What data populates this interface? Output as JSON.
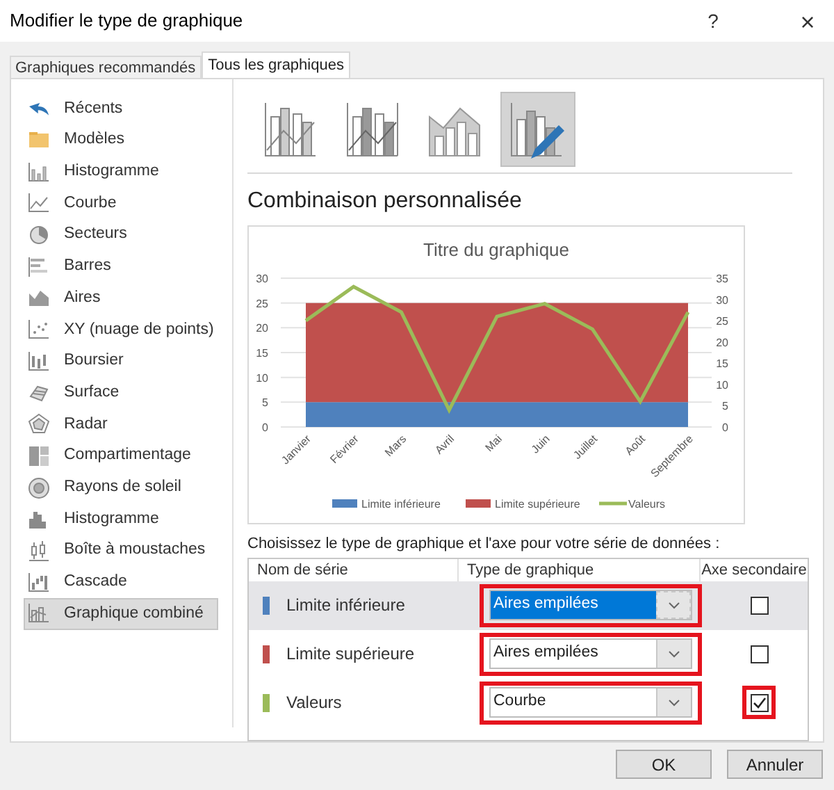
{
  "window": {
    "title": "Modifier le type de graphique",
    "help": "?",
    "close": "×"
  },
  "tabs": [
    {
      "label": "Graphiques recommandés",
      "selected": false
    },
    {
      "label": "Tous les graphiques",
      "selected": true
    }
  ],
  "sidebar": {
    "items": [
      {
        "label": "Récents",
        "selected": false
      },
      {
        "label": "Modèles",
        "selected": false
      },
      {
        "label": "Histogramme",
        "selected": false
      },
      {
        "label": "Courbe",
        "selected": false
      },
      {
        "label": "Secteurs",
        "selected": false
      },
      {
        "label": "Barres",
        "selected": false
      },
      {
        "label": "Aires",
        "selected": false
      },
      {
        "label": "XY (nuage de points)",
        "selected": false
      },
      {
        "label": "Boursier",
        "selected": false
      },
      {
        "label": "Surface",
        "selected": false
      },
      {
        "label": "Radar",
        "selected": false
      },
      {
        "label": "Compartimentage",
        "selected": false
      },
      {
        "label": "Rayons de soleil",
        "selected": false
      },
      {
        "label": "Histogramme",
        "selected": false
      },
      {
        "label": "Boîte à moustaches",
        "selected": false
      },
      {
        "label": "Cascade",
        "selected": false
      },
      {
        "label": "Graphique combiné",
        "selected": true
      }
    ]
  },
  "subtypes": [
    {
      "selected": false
    },
    {
      "selected": false
    },
    {
      "selected": false
    },
    {
      "selected": true
    }
  ],
  "heading": "Combinaison personnalisée",
  "chart_data": {
    "type": "area",
    "title": "Titre du graphique",
    "stacked": true,
    "grid": true,
    "legend": true,
    "categories": [
      "Janvier",
      "Février",
      "Mars",
      "Avril",
      "Mai",
      "Juin",
      "Juillet",
      "Août",
      "Septembre"
    ],
    "ylim": [
      0,
      30
    ],
    "yticks": [
      0,
      5,
      10,
      15,
      20,
      25,
      30
    ],
    "y2lim": [
      0,
      35
    ],
    "y2ticks": [
      0,
      5,
      10,
      15,
      20,
      25,
      30,
      35
    ],
    "series": [
      {
        "name": "Limite inférieure",
        "color": "#4f81bd",
        "values": [
          5,
          5,
          5,
          5,
          5,
          5,
          5,
          5,
          5
        ]
      },
      {
        "name": "Limite supérieure",
        "color": "#c0504d",
        "values": [
          20,
          20,
          20,
          20,
          20,
          20,
          20,
          20,
          20
        ]
      },
      {
        "name": "Valeurs",
        "color": "#9bbb59",
        "type": "line",
        "axis": "y2",
        "values": [
          25,
          33,
          27,
          4,
          26,
          29,
          23,
          6,
          27
        ]
      }
    ]
  },
  "series_table": {
    "prompt": "Choisissez le type de graphique et l'axe pour votre série de données :",
    "columns": [
      "Nom de série",
      "Type de graphique",
      "Axe secondaire"
    ],
    "rows": [
      {
        "name": "Limite inférieure",
        "color": "#4f81bd",
        "type": "Aires empilées",
        "secondary": false,
        "selected": true,
        "focused": true,
        "highlighted_type": true,
        "highlighted_axis": false
      },
      {
        "name": "Limite supérieure",
        "color": "#c0504d",
        "type": "Aires empilées",
        "secondary": false,
        "selected": false,
        "focused": false,
        "highlighted_type": true,
        "highlighted_axis": false
      },
      {
        "name": "Valeurs",
        "color": "#9bbb59",
        "type": "Courbe",
        "secondary": true,
        "selected": false,
        "focused": false,
        "highlighted_type": true,
        "highlighted_axis": true
      }
    ]
  },
  "buttons": [
    "OK",
    "Annuler"
  ]
}
